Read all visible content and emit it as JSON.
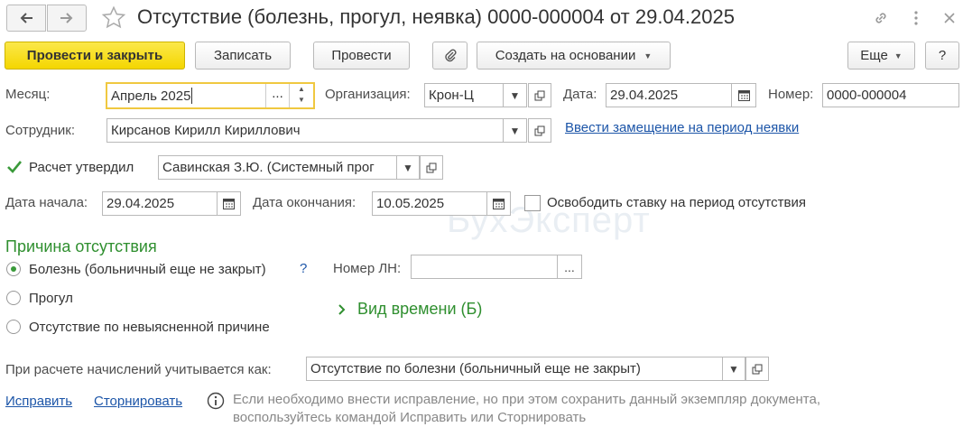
{
  "window": {
    "title": "Отсутствие (болезнь, прогул, неявка) 0000-000004 от 29.04.2025"
  },
  "toolbar": {
    "post_close": "Провести и закрыть",
    "save": "Записать",
    "post": "Провести",
    "create_based": "Создать на основании",
    "more": "Еще",
    "help": "?"
  },
  "fields": {
    "month_label": "Месяц:",
    "month_value": "Апрель 2025",
    "org_label": "Организация:",
    "org_value": "Крон-Ц",
    "date_label": "Дата:",
    "date_value": "29.04.2025",
    "number_label": "Номер:",
    "number_value": "0000-000004",
    "employee_label": "Сотрудник:",
    "employee_value": "Кирсанов Кирилл Кириллович",
    "replacement_link": "Ввести замещение на период неявки",
    "approved_label": "Расчет утвердил",
    "approved_value": "Савинская З.Ю. (Системный прог",
    "start_label": "Дата начала:",
    "start_value": "29.04.2025",
    "end_label": "Дата окончания:",
    "end_value": "10.05.2025",
    "free_rate_label": "Освободить ставку на период отсутствия"
  },
  "reason": {
    "heading": "Причина отсутствия",
    "options": [
      "Болезнь (больничный еще не закрыт)",
      "Прогул",
      "Отсутствие по невыясненной причине"
    ],
    "help_mark": "?",
    "ln_label": "Номер ЛН:",
    "ln_value": "",
    "time_type": "Вид времени (Б)"
  },
  "calc": {
    "label": "При расчете начислений учитывается как:",
    "value": "Отсутствие по болезни (больничный еще не закрыт)"
  },
  "footer": {
    "fix_link": "Исправить",
    "reverse_link": "Сторнировать",
    "info_line1": "Если необходимо внести исправление, но при этом сохранить данный экземпляр документа,",
    "info_line2": "воспользуйтесь командой Исправить или Сторнировать"
  },
  "watermark": "БухЭксперт"
}
